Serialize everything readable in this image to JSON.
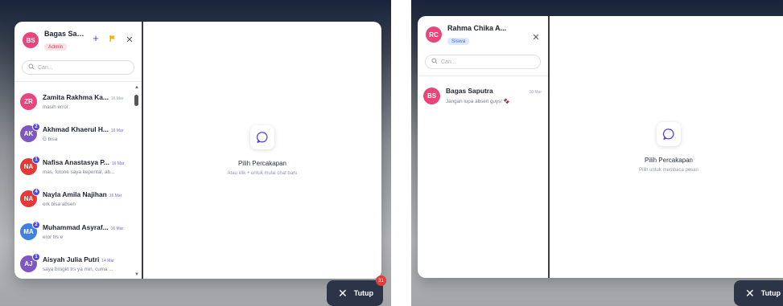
{
  "colors": {
    "accent": "#4f46e5",
    "admin_badge_bg": "#fde2e6",
    "siswa_badge_bg": "#dce8ff",
    "close_button_bg": "#2b3547",
    "unread_count_bg": "#e53935"
  },
  "left": {
    "user": {
      "initials": "BS",
      "name": "Bagas Saputra",
      "role": "Admin",
      "avatar_color": "#e8457b"
    },
    "header_icons": [
      "plus-icon",
      "flag-icon",
      "close-icon"
    ],
    "search": {
      "placeholder": "Cari..."
    },
    "conversations": [
      {
        "initials": "ZR",
        "name": "Zamita Rakhma Ka...",
        "date": "16 Mar",
        "preview": "masih error",
        "unread": "",
        "color": "#e8457b"
      },
      {
        "initials": "AK",
        "name": "Akhmad Khaerul H...",
        "date": "16 Mar",
        "preview": "G bisa",
        "unread": "2",
        "color": "#7e57c2"
      },
      {
        "initials": "NA",
        "name": "Nafisa Anastasya P...",
        "date": "16 Mar",
        "preview": "mas, fotone saya kepental, ab...",
        "unread": "1",
        "color": "#e53935"
      },
      {
        "initials": "NA",
        "name": "Nayla Amila Najihan",
        "date": "16 Mar",
        "preview": "ork bisa absen",
        "unread": "4",
        "color": "#e53935"
      },
      {
        "initials": "MA",
        "name": "Muhammad Asyraf...",
        "date": "16 Mar",
        "preview": "eror trs e",
        "unread": "2",
        "color": "#3f80e0"
      },
      {
        "initials": "AJ",
        "name": "Aisyah Julia Putri",
        "date": "14 Mar",
        "preview": "saya brngkt trs ya min, cuma ...",
        "unread": "1",
        "color": "#7e57c2"
      },
      {
        "initials": "",
        "name": "",
        "date": "",
        "preview": "",
        "unread": "",
        "color": "#5b6ee1"
      }
    ],
    "empty_state": {
      "title": "Pilih Percakapan",
      "subtitle": "Atau klik + untuk mulai chat baru"
    },
    "close_button": {
      "label": "Tutup",
      "count": "31"
    }
  },
  "right": {
    "user": {
      "initials": "RC",
      "name": "Rahma Chika A...",
      "role": "Siswa",
      "avatar_color": "#e8457b"
    },
    "header_icons": [
      "close-icon"
    ],
    "search": {
      "placeholder": "Cari..."
    },
    "conversations": [
      {
        "initials": "BS",
        "name": "Bagas Saputra",
        "date": "10 Mar",
        "preview": "Jangan lupa absen guys! 🍫",
        "unread": "",
        "color": "#e8457b"
      }
    ],
    "empty_state": {
      "title": "Pilih Percakapan",
      "subtitle": "Pilih untuk membaca pesan"
    },
    "close_button": {
      "label": "Tutup"
    }
  }
}
